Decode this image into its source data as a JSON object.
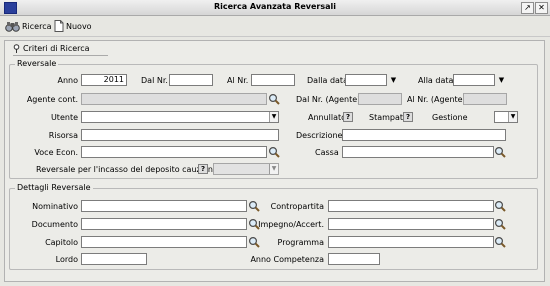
{
  "window": {
    "title": "Ricerca Avanzata Reversali",
    "controls": [
      "pin-icon",
      "close-icon"
    ]
  },
  "toolbar": {
    "search_label": "Ricerca",
    "new_label": "Nuovo"
  },
  "panel": {
    "title": "Criteri di Ricerca"
  },
  "reversale": {
    "legend": "Reversale",
    "anno_label": "Anno",
    "anno_value": "2011",
    "dal_nr_label": "Dal Nr.",
    "dal_nr_value": "",
    "al_nr_label": "Al Nr.",
    "al_nr_value": "",
    "dalla_data_label": "Dalla data",
    "dalla_data_value": "",
    "alla_data_label": "Alla data",
    "alla_data_value": "",
    "agente_label": "Agente cont.",
    "agente_value": "",
    "dal_nr_agente_label": "Dal Nr. (Agente)",
    "dal_nr_agente_value": "",
    "al_nr_agente_label": "Al Nr. (Agente)",
    "al_nr_agente_value": "",
    "utente_label": "Utente",
    "utente_value": "",
    "annullato_label": "Annullato",
    "stampato_label": "Stampato",
    "gestione_label": "Gestione",
    "gestione_value": "",
    "risorsa_label": "Risorsa",
    "risorsa_value": "",
    "descrizione_label": "Descrizione",
    "descrizione_value": "",
    "voce_econ_label": "Voce Econ.",
    "voce_econ_value": "",
    "cassa_label": "Cassa",
    "cassa_value": "",
    "deposito_label": "Reversale per l'incasso del deposito cauzionale",
    "deposito_value": ""
  },
  "dettagli": {
    "legend": "Dettagli Reversale",
    "nominativo_label": "Nominativo",
    "nominativo_value": "",
    "contropartita_label": "Contropartita",
    "contropartita_value": "",
    "documento_label": "Documento",
    "documento_value": "",
    "impegno_label": "Impegno/Accert.",
    "impegno_value": "",
    "capitolo_label": "Capitolo",
    "capitolo_value": "",
    "programma_label": "Programma",
    "programma_value": "",
    "lordo_label": "Lordo",
    "lordo_value": "",
    "anno_competenza_label": "Anno Competenza",
    "anno_competenza_value": ""
  },
  "colors": {
    "titlebar": "#d6d6d6",
    "background": "#e7e7e2",
    "panel": "#ecece8",
    "window_icon": "#2a3f9b"
  }
}
